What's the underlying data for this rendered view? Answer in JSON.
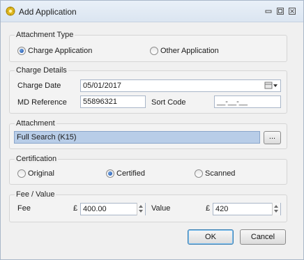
{
  "window": {
    "title": "Add Application"
  },
  "attachment_type": {
    "legend": "Attachment Type",
    "options": [
      {
        "label": "Charge Application",
        "checked": true
      },
      {
        "label": "Other Application",
        "checked": false
      }
    ]
  },
  "charge_details": {
    "legend": "Charge Details",
    "charge_date_label": "Charge Date",
    "charge_date_value": "05/01/2017",
    "md_reference_label": "MD Reference",
    "md_reference_value": "55896321",
    "sort_code_label": "Sort Code",
    "sort_code_value": "__-__-__"
  },
  "attachment": {
    "legend": "Attachment",
    "value": "Full Search (K15)",
    "browse_label": "..."
  },
  "certification": {
    "legend": "Certification",
    "options": [
      {
        "label": "Original",
        "checked": false
      },
      {
        "label": "Certified",
        "checked": true
      },
      {
        "label": "Scanned",
        "checked": false
      }
    ]
  },
  "fee_value": {
    "legend": "Fee / Value",
    "fee_label": "Fee",
    "fee_currency": "£",
    "fee_value": "400.00",
    "value_label": "Value",
    "value_currency": "£",
    "value_value": "420"
  },
  "buttons": {
    "ok": "OK",
    "cancel": "Cancel"
  },
  "colors": {
    "selection_bg": "#b8cde8",
    "title_bg": "#dbe5f1"
  }
}
